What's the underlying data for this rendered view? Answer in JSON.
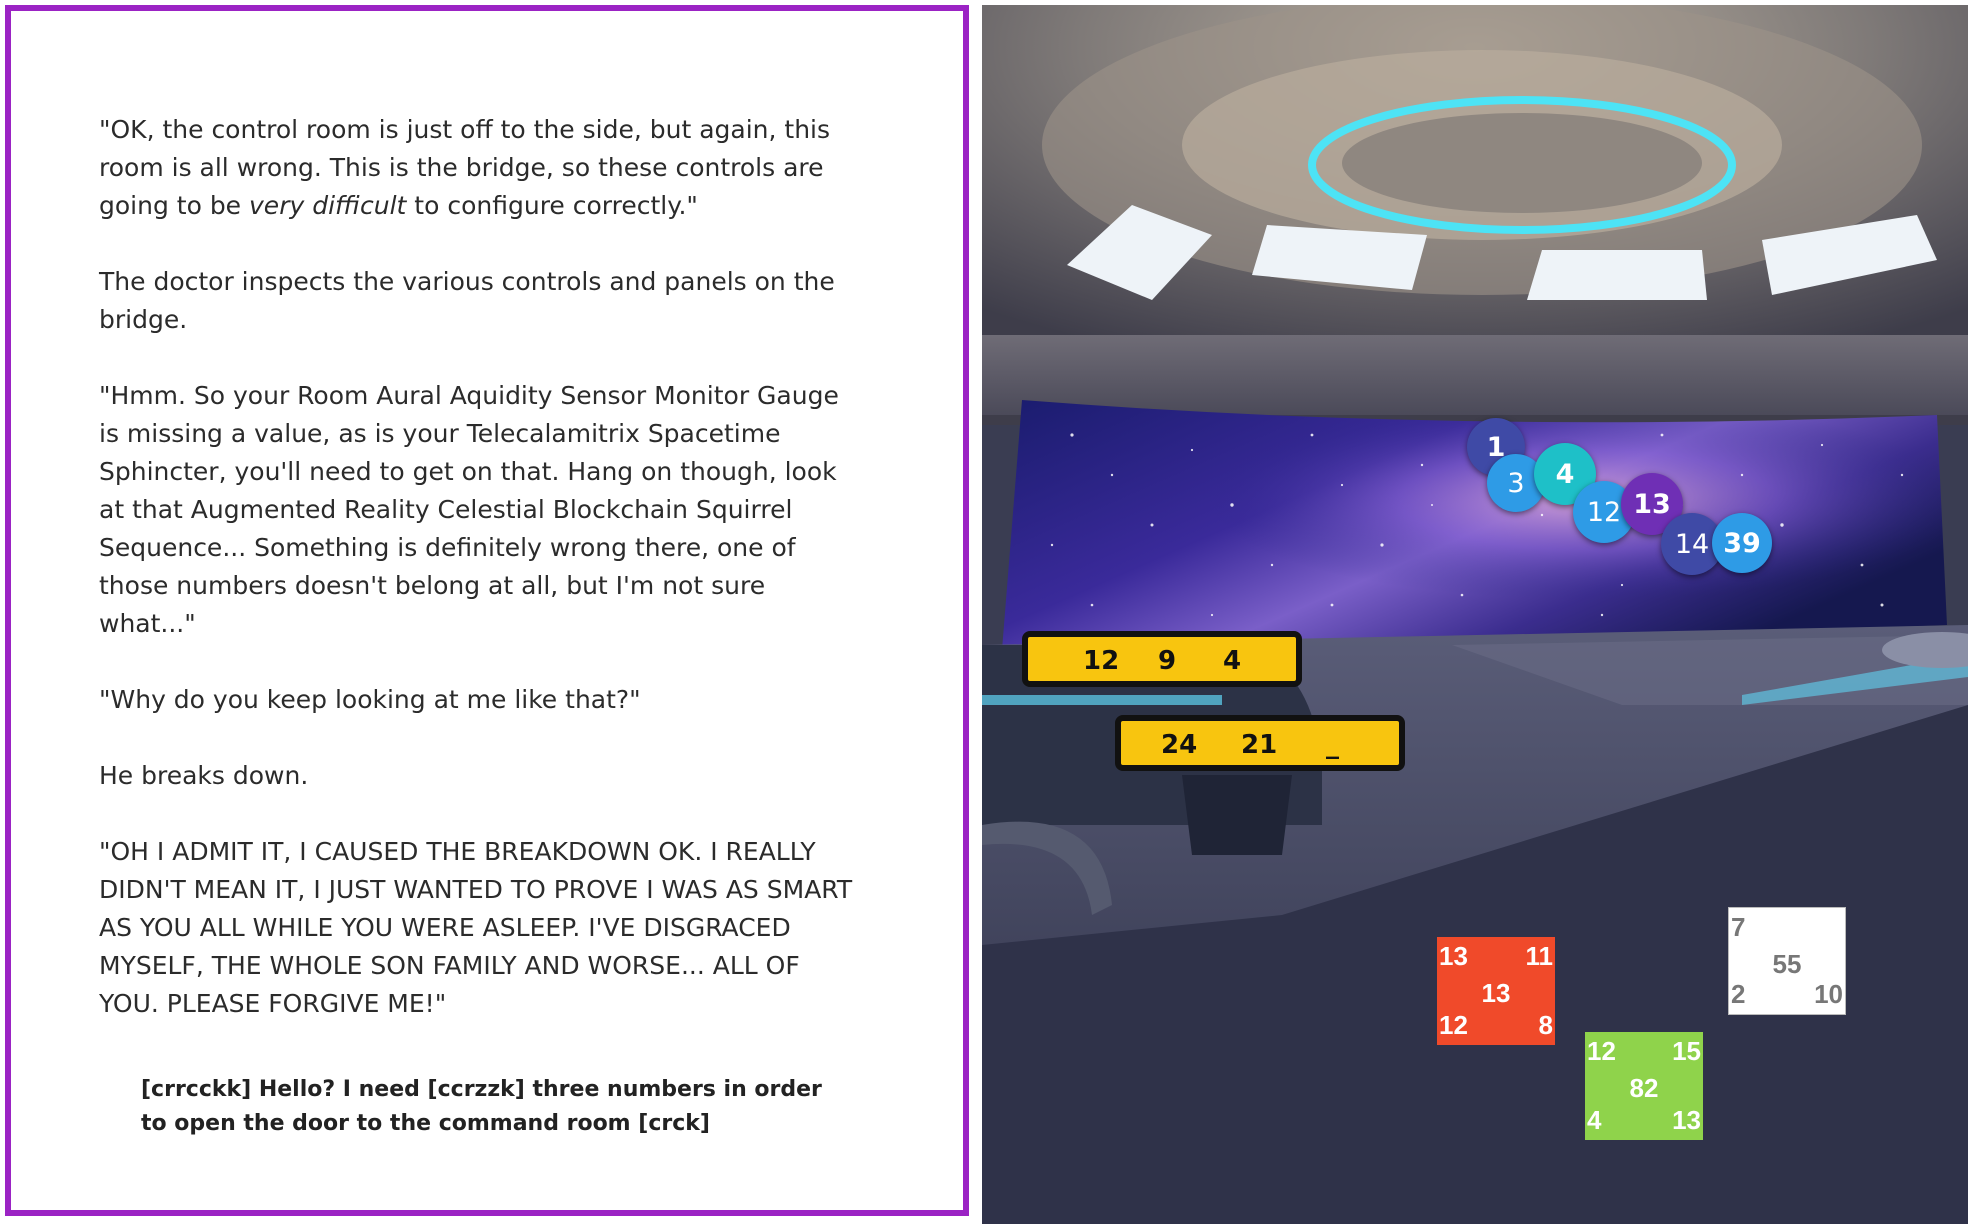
{
  "story": {
    "p1_start": "\"OK, the control room is just off to the side, but again, this room is all wrong. This is the bridge, so these controls are going to be ",
    "p1_em": "very difficult",
    "p1_end": " to configure correctly.\"",
    "p2": "The doctor inspects the various controls and panels on the bridge.",
    "p3": "\"Hmm. So your Room Aural Aquidity Sensor Monitor Gauge is missing a value, as is your Telecalamitrix Spacetime Sphincter, you'll need to get on that.  Hang on though, look at that Augmented Reality Celestial Blockchain Squirrel Sequence... Something is definitely wrong there, one of those numbers doesn't belong at all, but I'm not sure what...\"",
    "p4": "\"Why do you keep looking at me like that?\"",
    "p5": "He breaks down.",
    "p6": "\"OH I ADMIT IT, I CAUSED THE BREAKDOWN OK. I REALLY DIDN'T MEAN IT, I JUST WANTED TO PROVE I WAS AS SMART AS YOU ALL WHILE YOU WERE ASLEEP. I'VE DISGRACED MYSELF, THE WHOLE SON FAMILY AND WORSE... ALL OF YOU. PLEASE FORGIVE ME!\"",
    "radio": "[crrcckk] Hello? I need [ccrzzk] three numbers in order to open the door to the command room [crck]"
  },
  "sequence_balls": [
    {
      "label": "1",
      "color": "#3f4aa6",
      "bold": true
    },
    {
      "label": "3",
      "color": "#2e9be6",
      "bold": false
    },
    {
      "label": "4",
      "color": "#1ec0c8",
      "bold": true
    },
    {
      "label": "12",
      "color": "#2e9be6",
      "bold": false
    },
    {
      "label": "13",
      "color": "#6f2fb5",
      "bold": true
    },
    {
      "label": "14",
      "color": "#3f4aa6",
      "bold": false
    },
    {
      "label": "39",
      "color": "#2e9be6",
      "bold": true
    }
  ],
  "gauge_panels": [
    {
      "values": [
        "12",
        "9",
        "4"
      ]
    },
    {
      "values": [
        "24",
        "21",
        "_"
      ]
    }
  ],
  "squares": [
    {
      "color": "#f04a2a",
      "text_color": "#ffffff",
      "tl": "13",
      "tr": "11",
      "center": "13",
      "bl": "12",
      "br": "8"
    },
    {
      "color": "#ffffff",
      "text_color": "#777777",
      "tl": "7",
      "tr": "",
      "center": "55",
      "bl": "2",
      "br": "10"
    },
    {
      "color": "#8fd34b",
      "text_color": "#ffffff",
      "tl": "12",
      "tr": "15",
      "center": "82",
      "bl": "4",
      "br": "13"
    }
  ]
}
